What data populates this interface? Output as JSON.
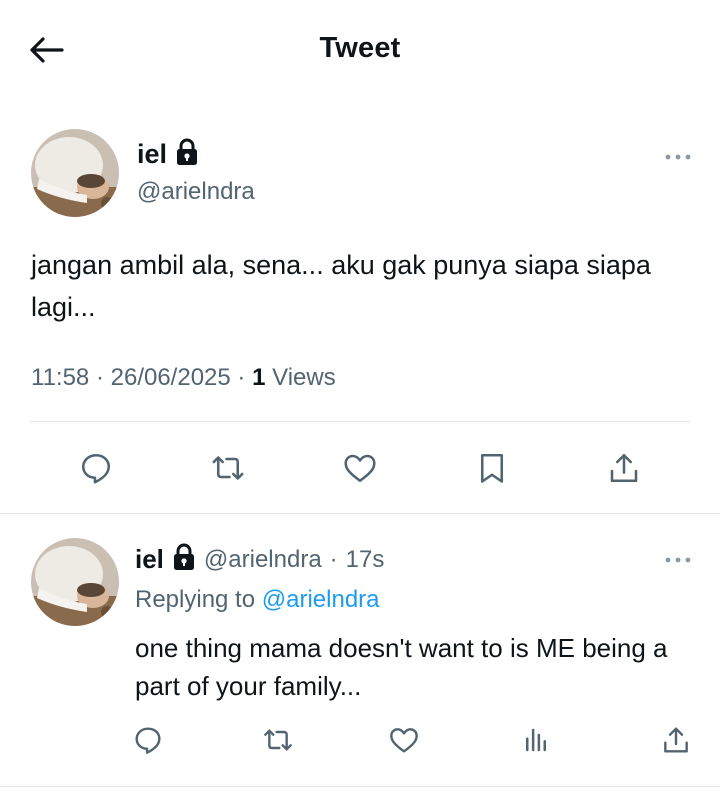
{
  "header": {
    "title": "Tweet",
    "back_icon": "arrow-left-icon"
  },
  "main_tweet": {
    "author_name": "iel",
    "handle": "@arielndra",
    "text": "jangan ambil ala, sena... aku gak punya siapa siapa lagi...",
    "time": "11:58",
    "date": "26/06/2025",
    "views_count": "1",
    "views_label": "Views",
    "actions": [
      "reply-icon",
      "retweet-icon",
      "like-icon",
      "bookmark-icon",
      "share-icon"
    ]
  },
  "reply_tweet": {
    "author_name": "iel",
    "handle": "@arielndra",
    "time": "17s",
    "replying_prefix": "Replying to",
    "replying_to": "@arielndra",
    "text": "one thing mama doesn't want to is ME being a part of your family...",
    "actions": [
      "reply-icon",
      "retweet-icon",
      "like-icon",
      "analytics-icon",
      "share-icon"
    ]
  },
  "colors": {
    "text_primary": "#0f1419",
    "text_secondary": "#536471",
    "link": "#1d9bf0",
    "divider": "#e1e6ea"
  }
}
